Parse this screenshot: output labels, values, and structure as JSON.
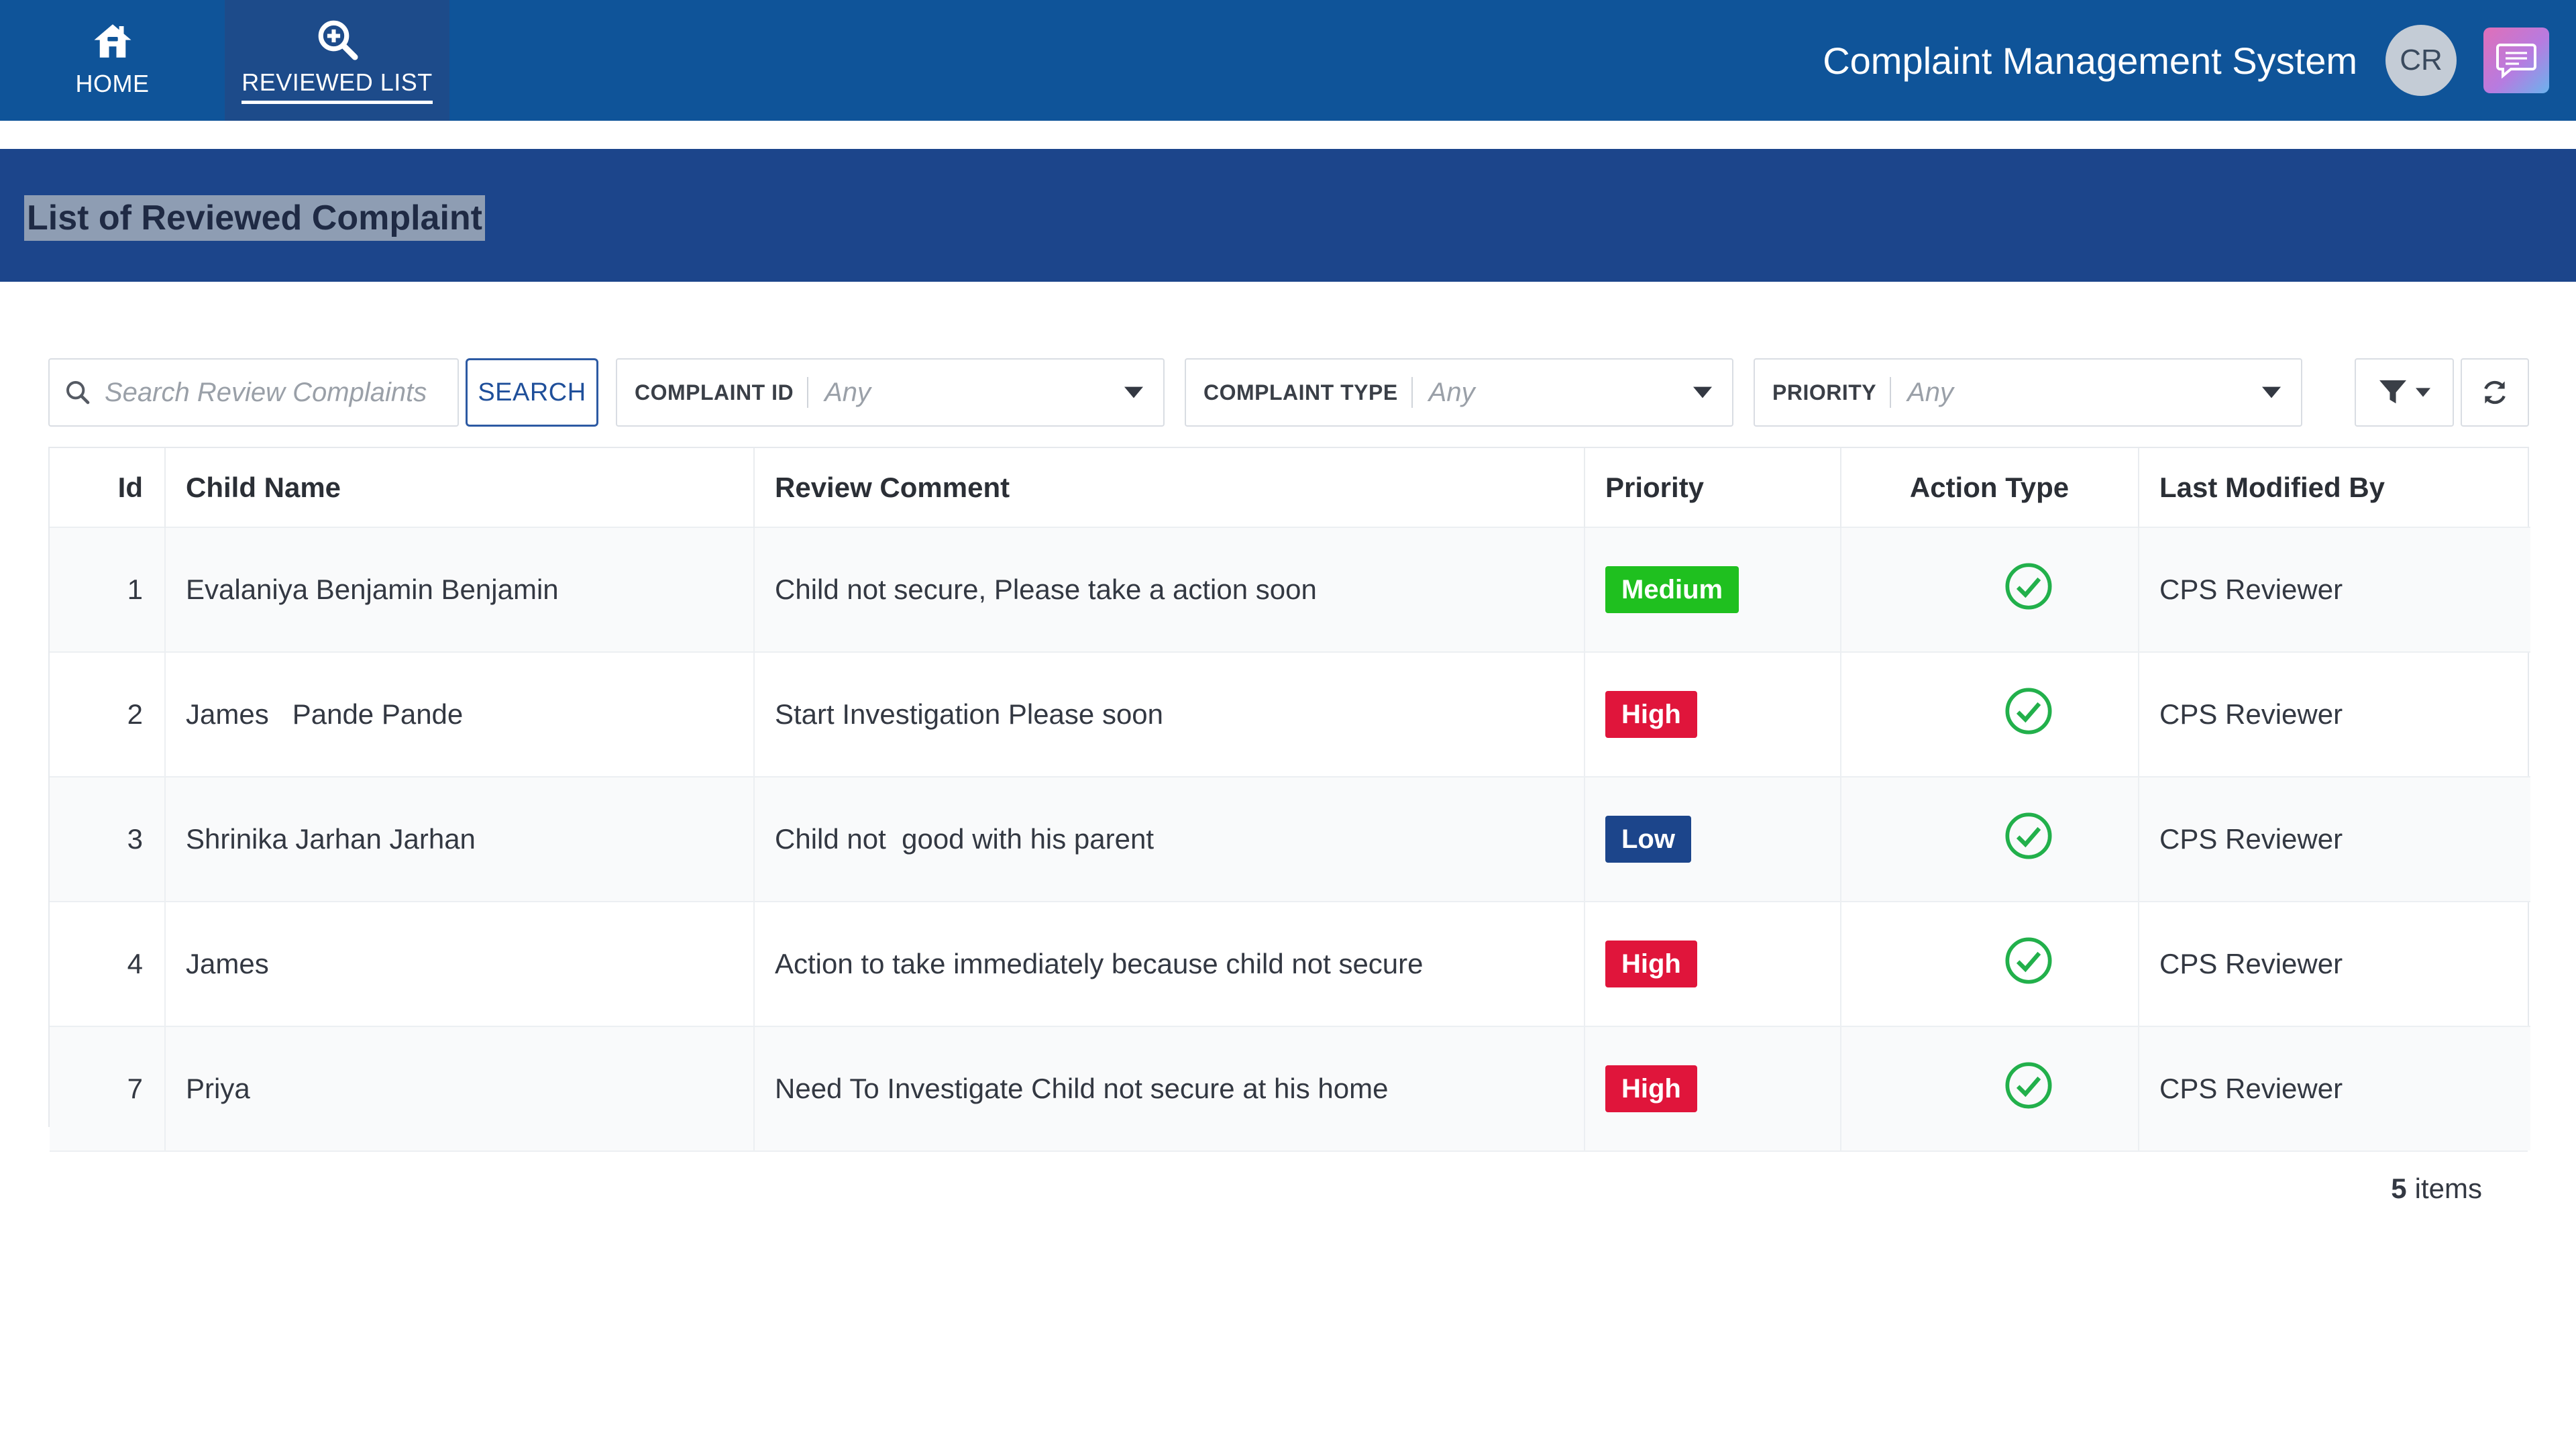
{
  "nav": {
    "items": [
      {
        "label": "HOME",
        "icon": "home-icon",
        "active": false
      },
      {
        "label": "REVIEWED LIST",
        "icon": "search-zoom-icon",
        "active": true
      }
    ]
  },
  "header": {
    "app_title": "Complaint Management System",
    "avatar_initials": "CR"
  },
  "page": {
    "title": "List of Reviewed Complaint"
  },
  "toolbar": {
    "search_placeholder": "Search Review Complaints",
    "search_label": "SEARCH",
    "filters": [
      {
        "label": "COMPLAINT ID",
        "value": "Any"
      },
      {
        "label": "COMPLAINT TYPE",
        "value": "Any"
      },
      {
        "label": "PRIORITY",
        "value": "Any"
      }
    ]
  },
  "table": {
    "columns": [
      "Id",
      "Child Name",
      "Review Comment",
      "Priority",
      "Action Type",
      "Last Modified By"
    ],
    "rows": [
      {
        "id": "1",
        "child_name": "Evalaniya Benjamin Benjamin",
        "comment": "Child not secure, Please take a action soon",
        "priority": "Medium",
        "action": "check-circle-icon",
        "modified_by": "CPS Reviewer"
      },
      {
        "id": "2",
        "child_name": "James   Pande Pande",
        "comment": "Start Investigation Please soon",
        "priority": "High",
        "action": "check-circle-icon",
        "modified_by": "CPS Reviewer"
      },
      {
        "id": "3",
        "child_name": "Shrinika Jarhan Jarhan",
        "comment": "Child not  good with his parent",
        "priority": "Low",
        "action": "check-circle-icon",
        "modified_by": "CPS Reviewer"
      },
      {
        "id": "4",
        "child_name": "James",
        "comment": "Action to take immediately because child not secure",
        "priority": "High",
        "action": "check-circle-icon",
        "modified_by": "CPS Reviewer"
      },
      {
        "id": "7",
        "child_name": "Priya",
        "comment": "Need To Investigate Child not secure at his home",
        "priority": "High",
        "action": "check-circle-icon",
        "modified_by": "CPS Reviewer"
      }
    ],
    "footer": {
      "count": "5",
      "items_label": "items"
    }
  },
  "colors": {
    "nav_bg": "#0f5499",
    "header_bg": "#1c458b",
    "priority_medium": "#1fc01f",
    "priority_high": "#e0153b",
    "priority_low": "#1c458b",
    "check": "#22b04b"
  }
}
